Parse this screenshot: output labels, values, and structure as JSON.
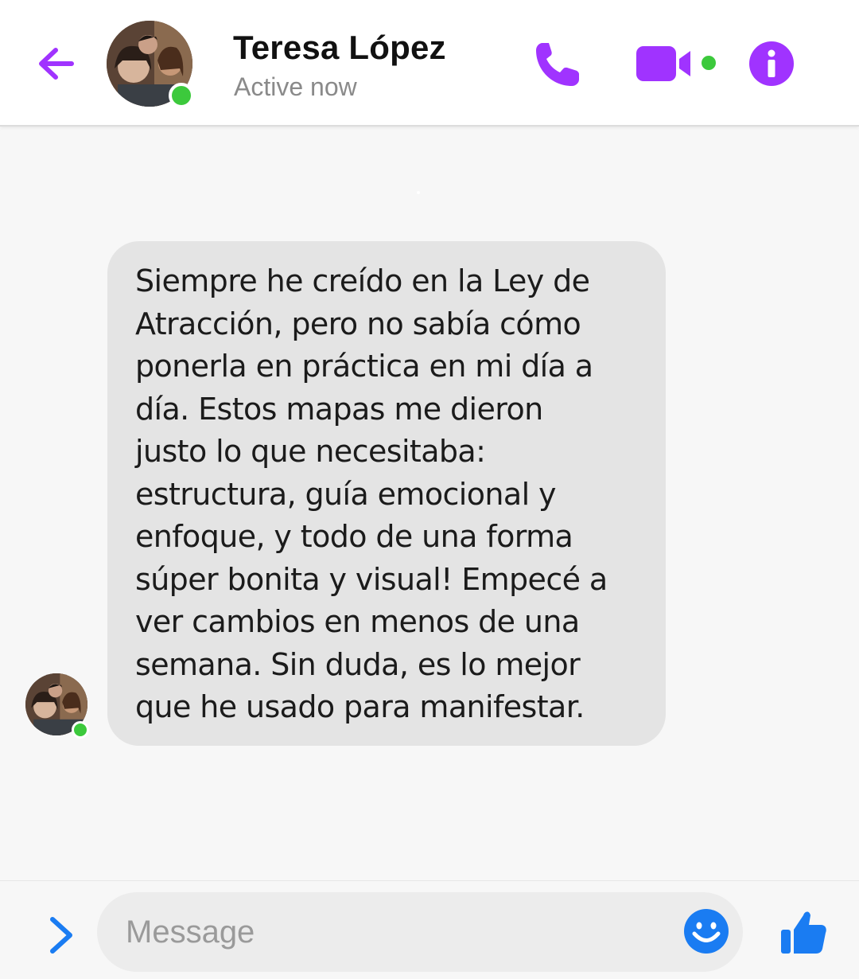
{
  "header": {
    "contact_name": "Teresa López",
    "status": "Active now",
    "accent_color": "#a033ff",
    "online_color": "#3cc93c",
    "icons": [
      "back-arrow-icon",
      "phone-icon",
      "video-camera-icon",
      "info-icon"
    ]
  },
  "conversation": {
    "messages": [
      {
        "sender": "Teresa López",
        "text": "Siempre he creído en la Ley de\nAtracción, pero no sabía cómo\nponerla en práctica en mi día a\ndía. Estos mapas me dieron\njusto lo que necesitaba:\nestructura, guía emocional y\nenfoque, y todo de una forma\nsúper bonita y visual! Empecé a\nver cambios en menos de una\nsemana. Sin duda, es lo mejor\nque he usado para manifestar."
      }
    ]
  },
  "composer": {
    "placeholder": "Message",
    "value": "",
    "icon_color": "#1a7cf2",
    "icons": [
      "chevron-right-icon",
      "emoji-icon",
      "thumbs-up-icon"
    ]
  }
}
